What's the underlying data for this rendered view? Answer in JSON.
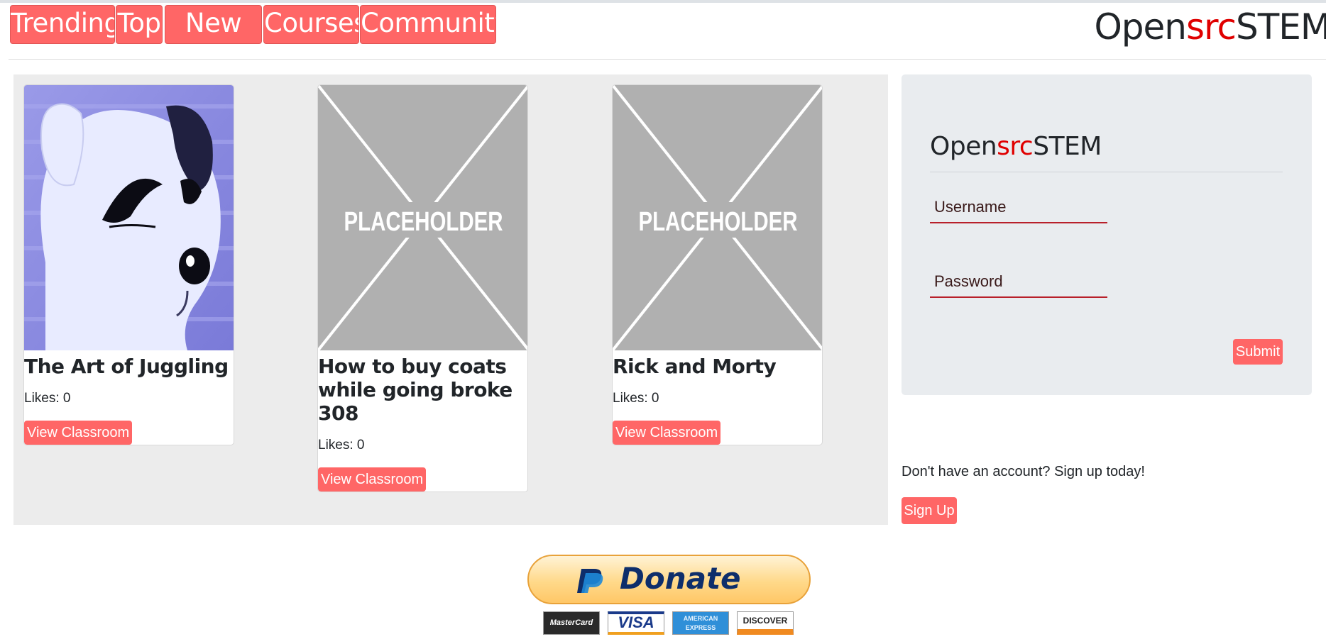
{
  "nav": {
    "items": [
      {
        "label": "Trending"
      },
      {
        "label": "Top"
      },
      {
        "label": "New"
      },
      {
        "label": "Courses"
      },
      {
        "label": "Community"
      }
    ]
  },
  "brand": {
    "part1": "Open",
    "part2": "src",
    "part3": "STEM"
  },
  "courses": [
    {
      "title": "The Art of Juggling",
      "likes": "Likes: 0",
      "button": "View Classroom"
    },
    {
      "title": "How to buy coats while going broke 308",
      "likes": "Likes: 0",
      "button": "View Classroom"
    },
    {
      "title": "Rick and Morty",
      "likes": "Likes: 0",
      "button": "View Classroom"
    }
  ],
  "placeholder_text": "PLACEHOLDER",
  "login": {
    "username_placeholder": "Username",
    "password_placeholder": "Password",
    "submit": "Submit"
  },
  "signup": {
    "text": "Don't have an account? Sign up today!",
    "button": "Sign Up"
  },
  "donate": {
    "label": "Donate",
    "cards": [
      "MasterCard",
      "VISA",
      "AMERICAN EXPRESS",
      "DISCOVER"
    ]
  },
  "colors": {
    "accent": "#ff6666",
    "brand_red": "#e00000",
    "panel": "#e9ecef",
    "courses_bg": "#ececec"
  }
}
